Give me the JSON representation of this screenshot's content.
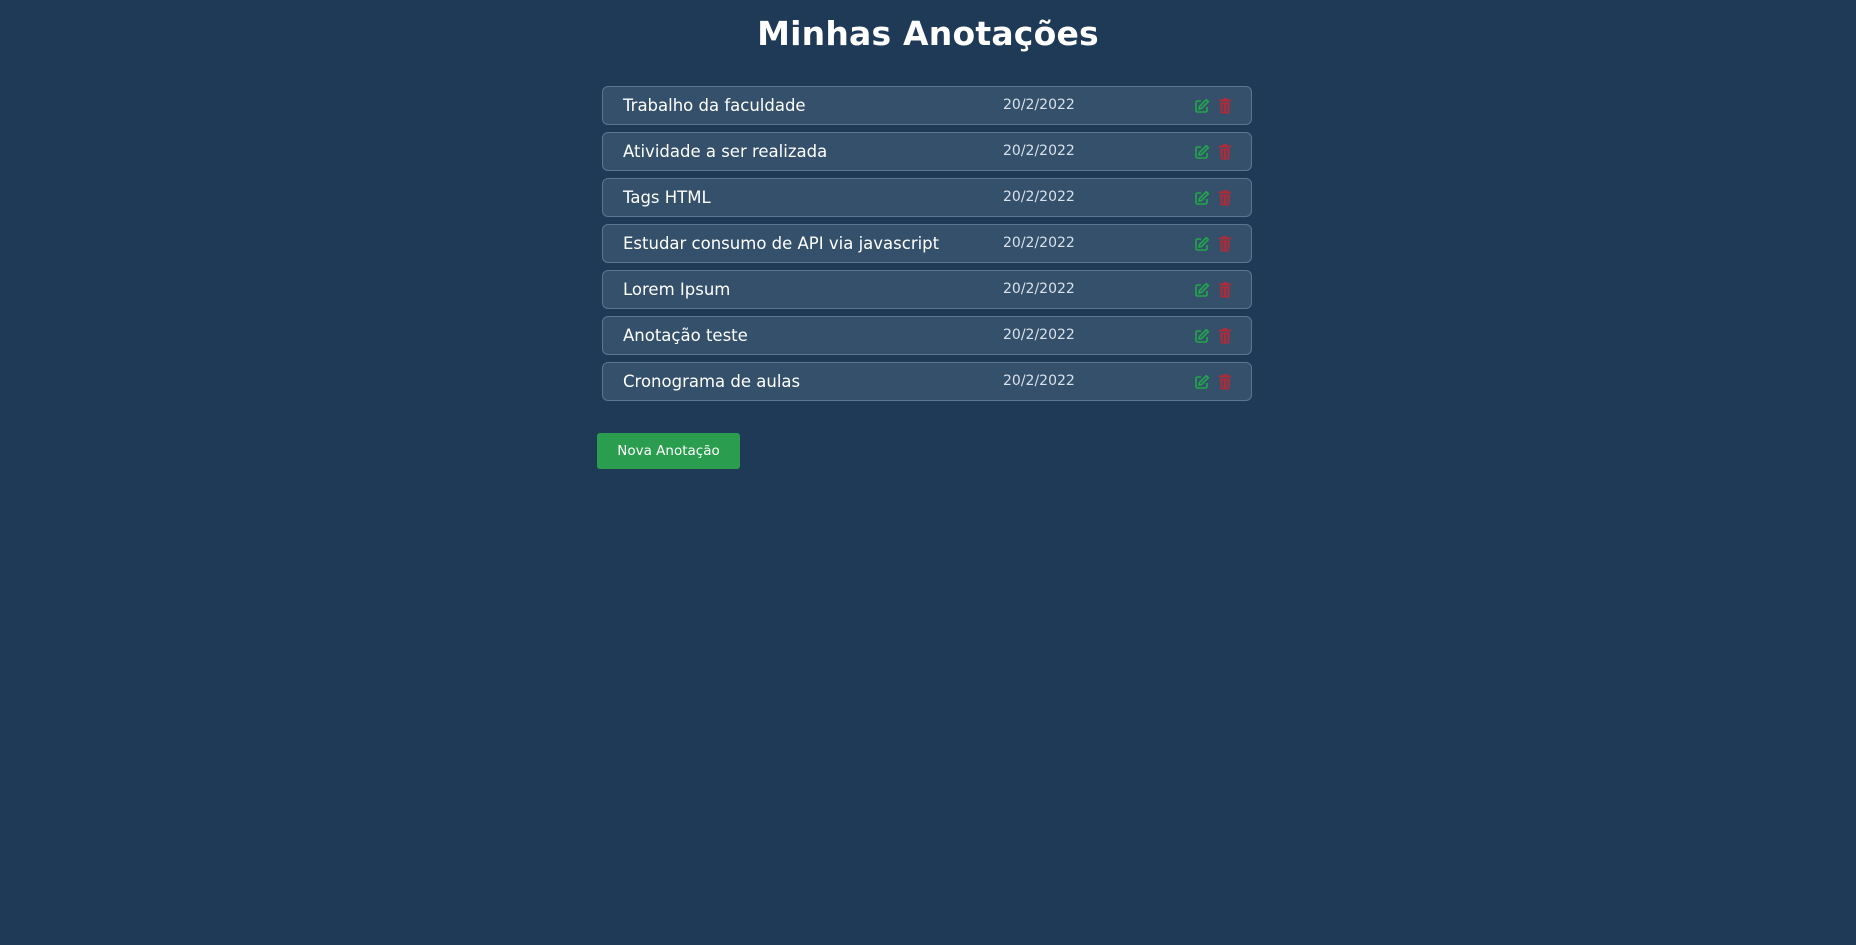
{
  "page": {
    "title": "Minhas Anotações"
  },
  "notes": [
    {
      "title": "Trabalho da faculdade",
      "date": "20/2/2022"
    },
    {
      "title": "Atividade a ser realizada",
      "date": "20/2/2022"
    },
    {
      "title": "Tags HTML",
      "date": "20/2/2022"
    },
    {
      "title": "Estudar consumo de API via javascript",
      "date": "20/2/2022"
    },
    {
      "title": "Lorem Ipsum",
      "date": "20/2/2022"
    },
    {
      "title": "Anotação teste",
      "date": "20/2/2022"
    },
    {
      "title": "Cronograma de aulas",
      "date": "20/2/2022"
    }
  ],
  "actions": {
    "new_note_label": "Nova Anotação"
  },
  "icons": {
    "edit": "edit-icon",
    "delete": "trash-icon"
  },
  "colors": {
    "background": "#1e3a56",
    "row_background": "#34506b",
    "row_border": "#5b7690",
    "accent_green": "#2a9d4e",
    "edit_icon": "#22a84a",
    "delete_icon": "#b02a37"
  }
}
